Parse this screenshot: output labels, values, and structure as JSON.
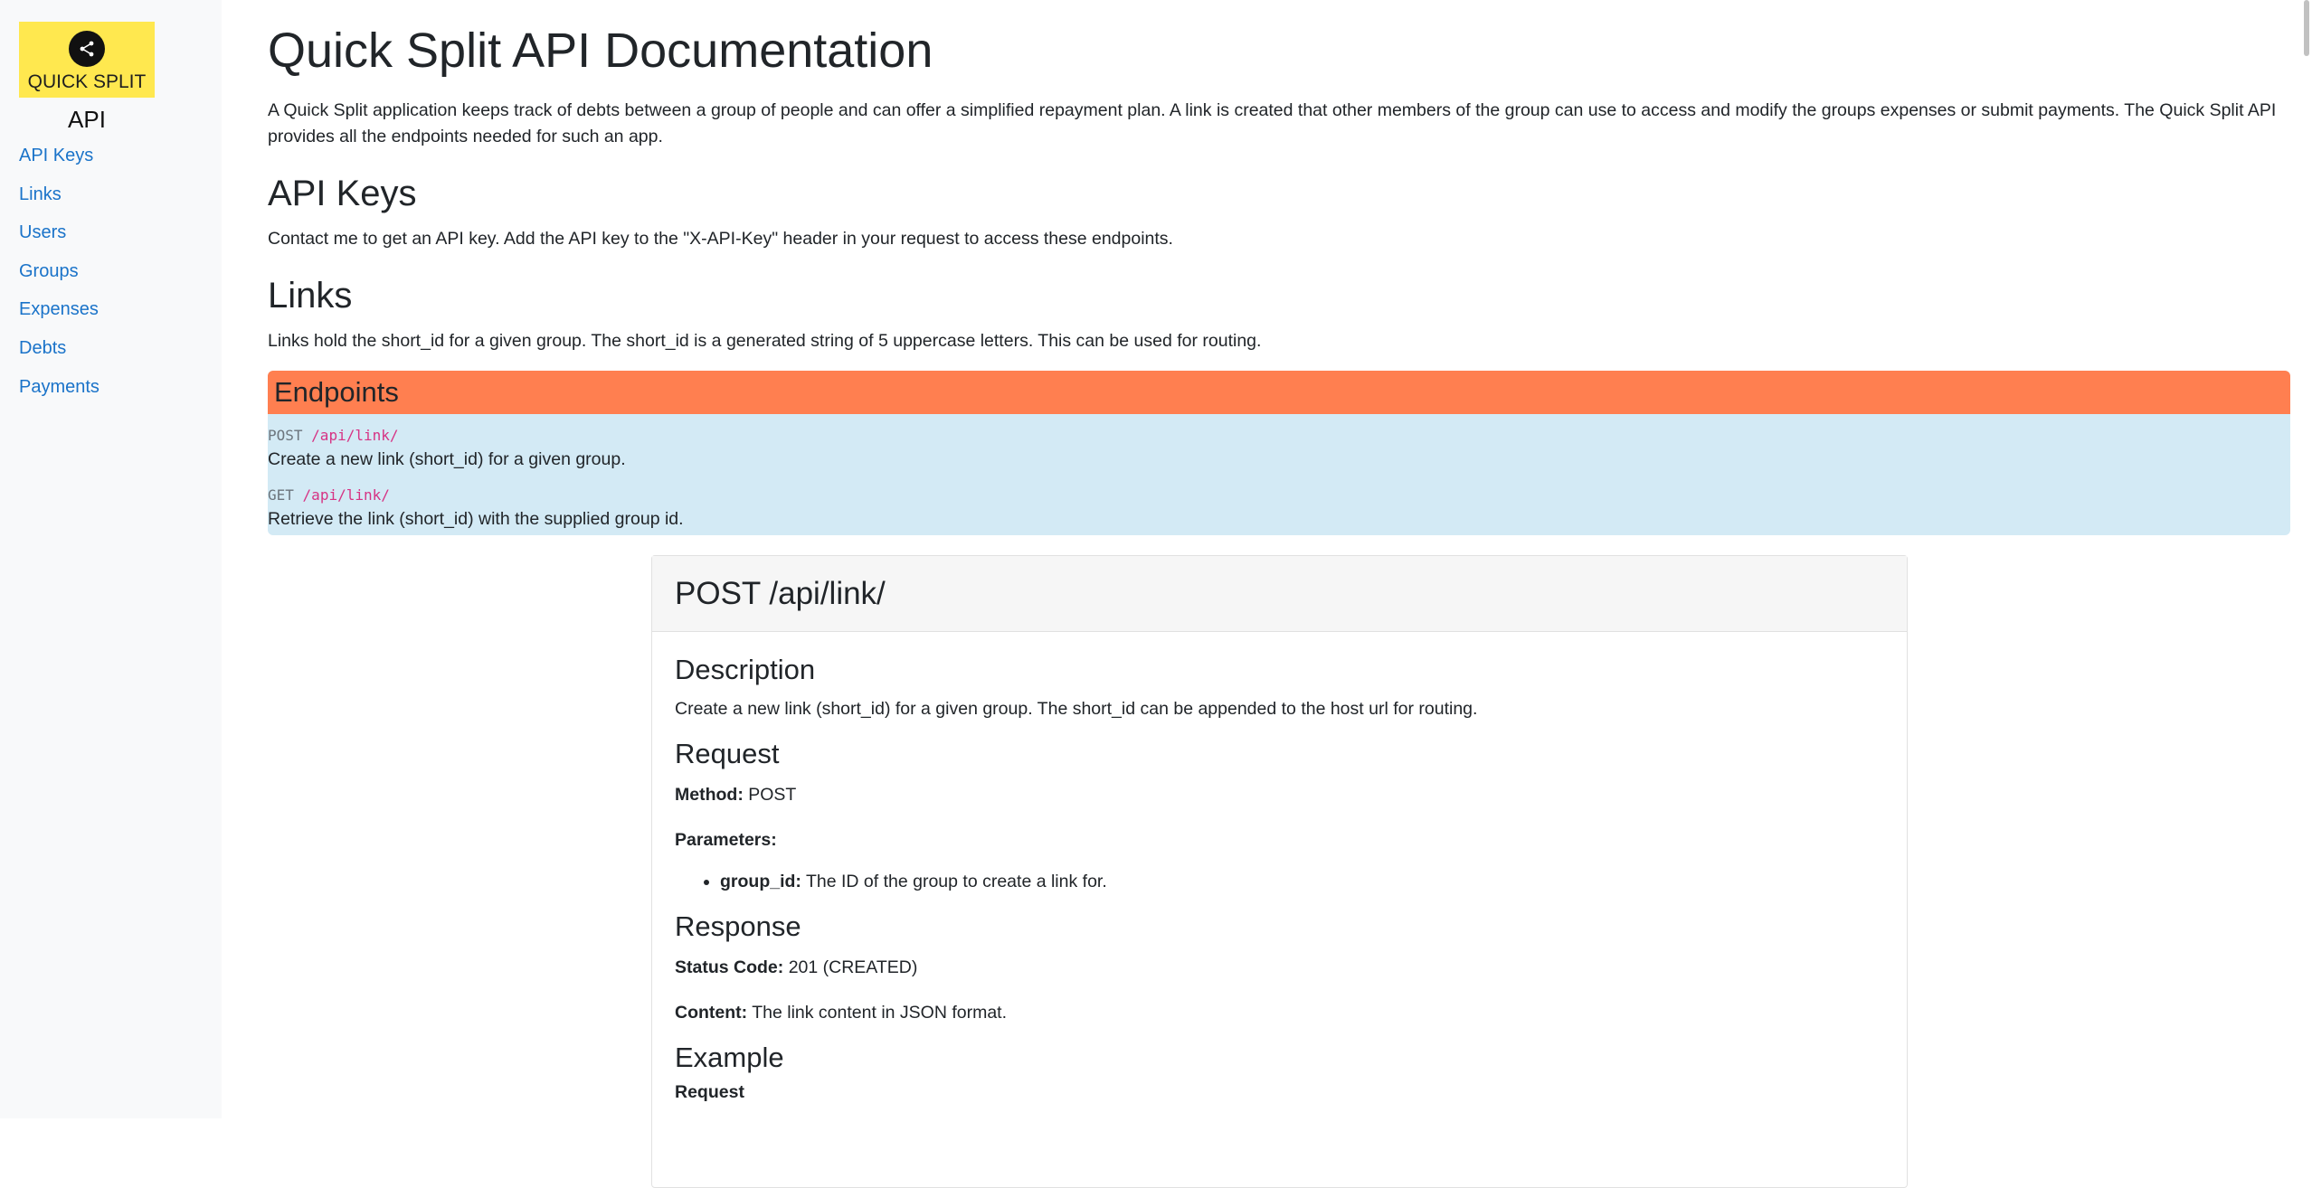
{
  "sidebar": {
    "logo_text": "QUICK SPLIT",
    "api_title": "API",
    "items": [
      {
        "label": "API Keys"
      },
      {
        "label": "Links"
      },
      {
        "label": "Users"
      },
      {
        "label": "Groups"
      },
      {
        "label": "Expenses"
      },
      {
        "label": "Debts"
      },
      {
        "label": "Payments"
      }
    ]
  },
  "main": {
    "title": "Quick Split API Documentation",
    "intro": "A Quick Split application keeps track of debts between a group of people and can offer a simplified repayment plan. A link is created that other members of the group can use to access and modify the groups expenses or submit payments. The Quick Split API provides all the endpoints needed for such an app.",
    "api_keys": {
      "heading": "API Keys",
      "text": "Contact me to get an API key. Add the API key to the \"X-API-Key\" header in your request to access these endpoints."
    },
    "links": {
      "heading": "Links",
      "text": "Links hold the short_id for a given group. The short_id is a generated string of 5 uppercase letters. This can be used for routing."
    },
    "endpoints": {
      "heading": "Endpoints",
      "items": [
        {
          "method": "POST",
          "path": "/api/link/",
          "desc": "Create a new link (short_id) for a given group."
        },
        {
          "method": "GET",
          "path": "/api/link/",
          "desc": "Retrieve the link (short_id) with the supplied group id."
        }
      ]
    },
    "card": {
      "header": "POST /api/link/",
      "description_heading": "Description",
      "description_text": "Create a new link (short_id) for a given group. The short_id can be appended to the host url for routing.",
      "request_heading": "Request",
      "method_label": "Method:",
      "method_value": "POST",
      "parameters_label": "Parameters:",
      "param_name": "group_id:",
      "param_desc": "The ID of the group to create a link for.",
      "response_heading": "Response",
      "status_label": "Status Code:",
      "status_value": "201 (CREATED)",
      "content_label": "Content:",
      "content_value": "The link content in JSON format.",
      "example_heading": "Example",
      "example_request_label": "Request"
    }
  },
  "colors": {
    "logo_bg": "#ffe84f",
    "endpoints_header": "#ff7f50",
    "endpoints_bg": "#d3eaf5",
    "link": "#1a73c9",
    "code_path": "#d63384"
  }
}
